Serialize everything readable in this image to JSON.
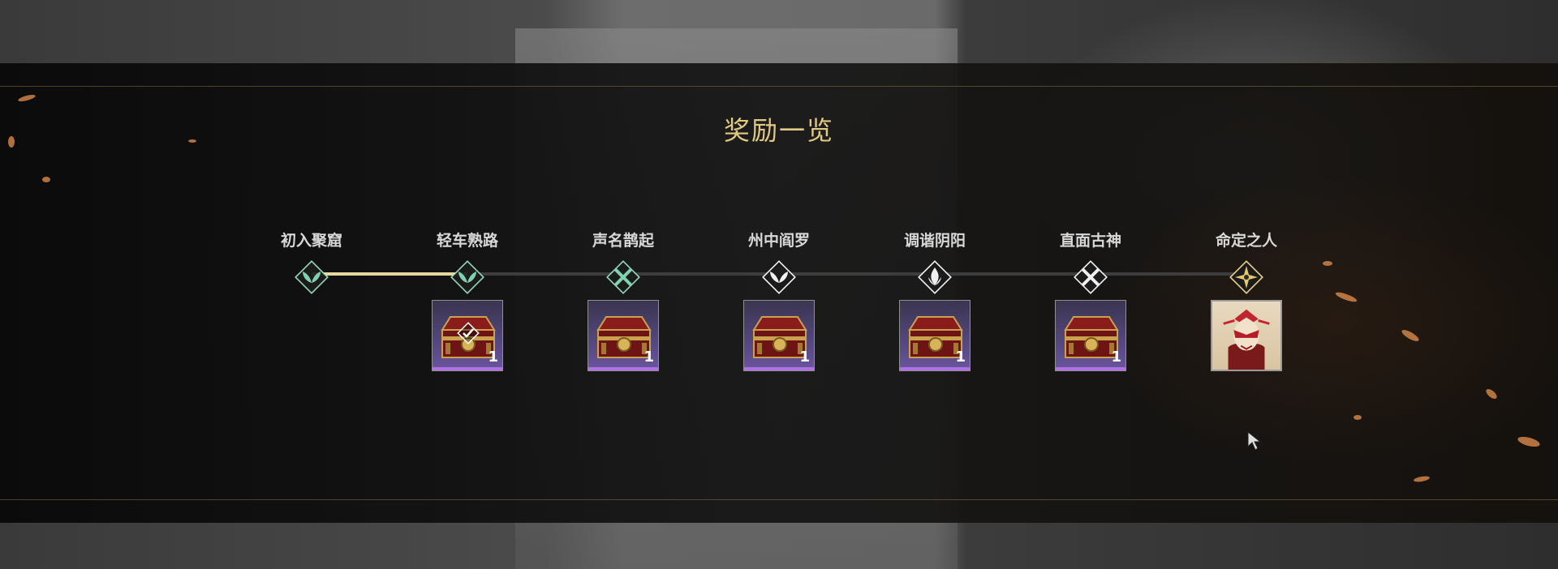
{
  "modal": {
    "title": "奖励一览"
  },
  "colors": {
    "title": "#e2c982",
    "progress": "#e6d79c",
    "track": "#3d3d3d",
    "rarity_purple": "#b070e6"
  },
  "progress": {
    "completed_stages": 2,
    "total_stages": 7
  },
  "stages": [
    {
      "label": "初入聚窟",
      "icon": "leaf-emblem-green-icon",
      "reward": null
    },
    {
      "label": "轻车熟路",
      "icon": "leaf-emblem-green-icon",
      "reward": {
        "icon": "treasure-chest-icon",
        "quantity": "1",
        "claimed": true
      }
    },
    {
      "label": "声名鹊起",
      "icon": "crossed-blades-green-icon",
      "reward": {
        "icon": "treasure-chest-icon",
        "quantity": "1",
        "claimed": false
      }
    },
    {
      "label": "州中阎罗",
      "icon": "leaf-emblem-white-icon",
      "reward": {
        "icon": "treasure-chest-icon",
        "quantity": "1",
        "claimed": false
      }
    },
    {
      "label": "调谐阴阳",
      "icon": "flame-emblem-white-icon",
      "reward": {
        "icon": "treasure-chest-icon",
        "quantity": "1",
        "claimed": false
      }
    },
    {
      "label": "直面古神",
      "icon": "crossed-blades-white-icon",
      "reward": {
        "icon": "treasure-chest-icon",
        "quantity": "1",
        "claimed": false
      }
    },
    {
      "label": "命定之人",
      "icon": "star-emblem-gold-icon",
      "reward": {
        "icon": "masked-character-avatar-icon",
        "quantity": "",
        "claimed": false
      }
    }
  ]
}
